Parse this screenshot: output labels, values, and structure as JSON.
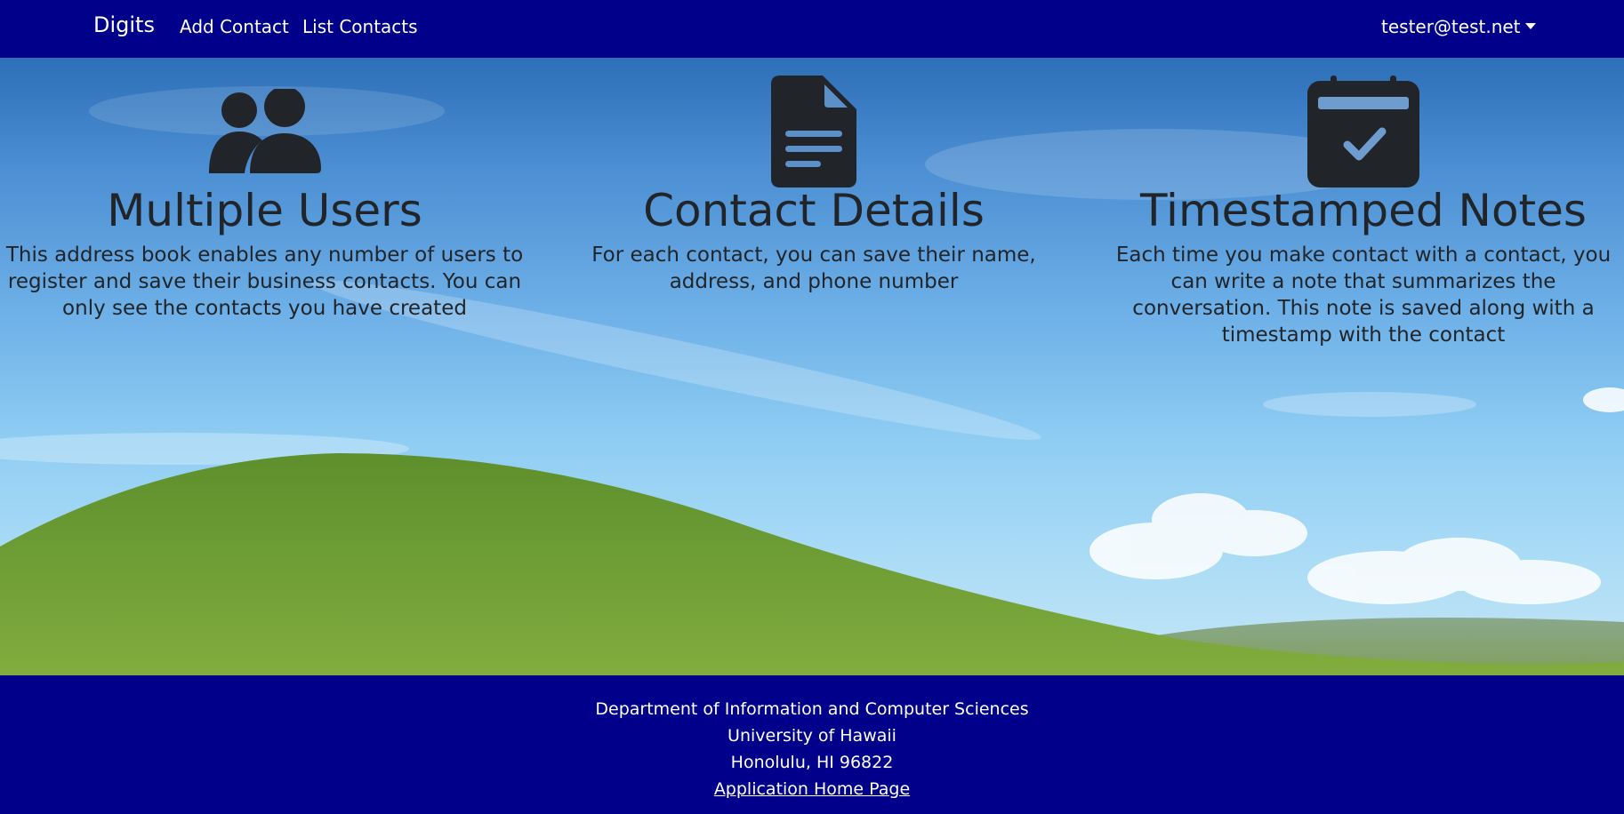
{
  "navbar": {
    "brand": "Digits",
    "links": [
      "Add Contact",
      "List Contacts"
    ],
    "user": "tester@test.net"
  },
  "features": [
    {
      "icon": "users-icon",
      "title": "Multiple Users",
      "text": "This address book enables any number of users to register and save their business contacts. You can only see the contacts you have created"
    },
    {
      "icon": "file-text-icon",
      "title": "Contact Details",
      "text": "For each contact, you can save their name, address, and phone number"
    },
    {
      "icon": "calendar-check-icon",
      "title": "Timestamped Notes",
      "text": "Each time you make contact with a contact, you can write a note that summarizes the conversation. This note is saved along with a timestamp with the contact"
    }
  ],
  "footer": {
    "lines": [
      "Department of Information and Computer Sciences",
      "University of Hawaii",
      "Honolulu, HI 96822"
    ],
    "link": "Application Home Page"
  },
  "colors": {
    "navbar": "#00008b",
    "footer": "#00008b",
    "icon": "#212529",
    "text": "#212529"
  }
}
